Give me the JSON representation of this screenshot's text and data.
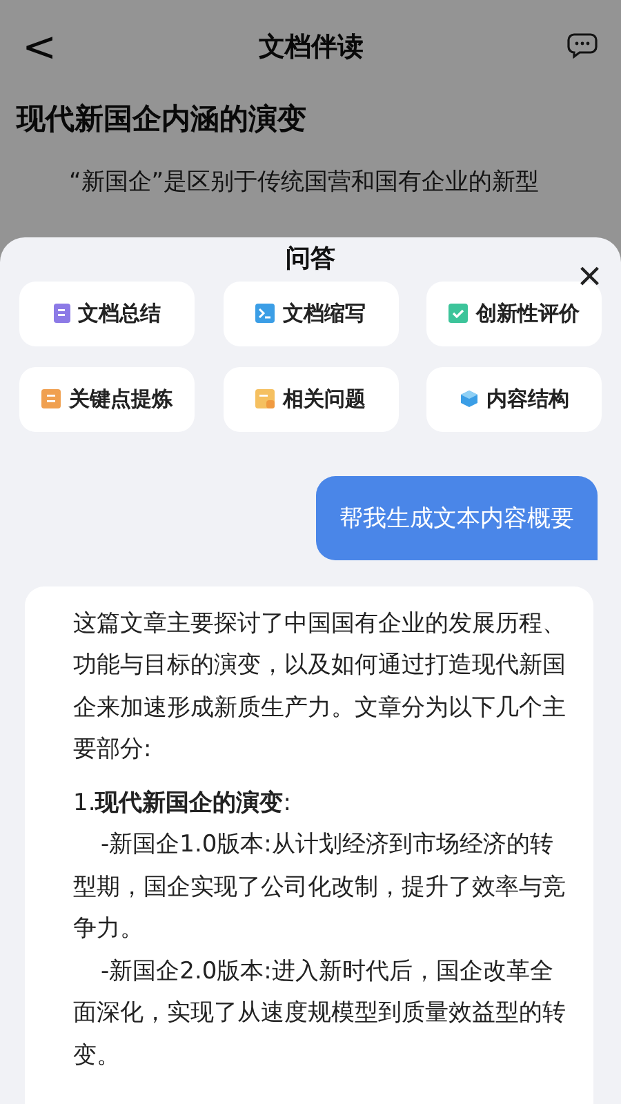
{
  "header": {
    "back": "<",
    "title": "文档伴读"
  },
  "article": {
    "title": "现代新国企内涵的演变",
    "paragraph": "“新国企”是区别于传统国营和国有企业的新型"
  },
  "sheet": {
    "title": "问答",
    "close": "×",
    "actions": [
      {
        "label": "文档总结"
      },
      {
        "label": "文档缩写"
      },
      {
        "label": "创新性评价"
      },
      {
        "label": "关键点提炼"
      },
      {
        "label": "相关问题"
      },
      {
        "label": "内容结构"
      }
    ],
    "messages": [
      {
        "kind": "user",
        "text": "帮我生成文本内容概要"
      },
      {
        "kind": "answer",
        "paragraphs": [
          {
            "kind": "text",
            "text": "这篇文章主要探讨了中国国有企业的发展历程、功能与目标的演变，以及如何通过打造现代新国企来加速形成新质生产力。文章分为以下几个主要部分:"
          },
          {
            "kind": "heading",
            "text": "1.**现代新国企的演变**:"
          },
          {
            "kind": "bullet",
            "text": "-新国企1.0版本:从计划经济到市场经济的转型期，国企实现了公司化改制，提升了效率与竞争力。"
          },
          {
            "kind": "bullet",
            "text": "-新国企2.0版本:进入新时代后，国企改革全面深化，实现了从速度规模型到质量效益型的转变。"
          }
        ]
      }
    ]
  }
}
